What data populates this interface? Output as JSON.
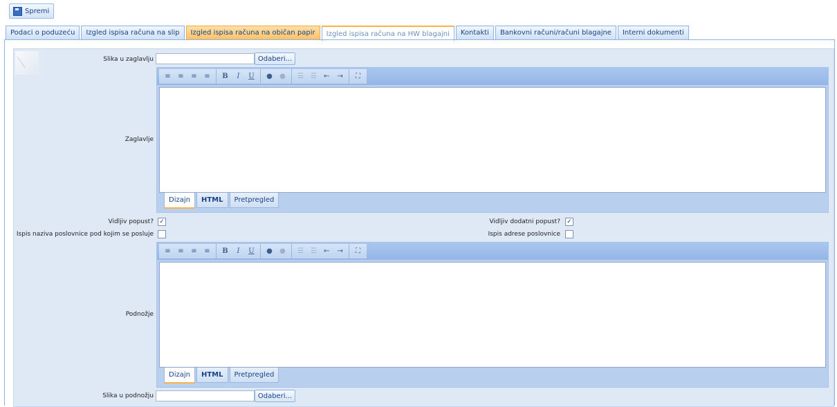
{
  "toolbar": {
    "save_label": "Spremi"
  },
  "tabs": [
    "Podaci o poduzeću",
    "Izgled ispisa računa na slip",
    "Izgled ispisa računa na običan papir",
    "Izgled ispisa računa na HW blagajni",
    "Kontakti",
    "Bankovni računi/računi blagajne",
    "Interni dokumenti"
  ],
  "form": {
    "header_image_label": "Slika u zaglavlju",
    "header_image_value": "",
    "browse_label": "Odaberi...",
    "header_label": "Zaglavlje",
    "footer_label": "Podnožje",
    "footer_image_label": "Slika u podnožju",
    "footer_image_value": "",
    "show_discount_label": "Vidljiv popust?",
    "show_discount_checked": true,
    "show_extra_discount_label": "Vidljiv dodatni popust?",
    "show_extra_discount_checked": true,
    "print_branch_name_label": "Ispis naziva poslovnice pod kojim se posluje",
    "print_branch_name_checked": false,
    "print_branch_address_label": "Ispis adrese poslovnice",
    "print_branch_address_checked": false
  },
  "editor": {
    "modes": [
      "Dizajn",
      "HTML",
      "Pretpregled"
    ],
    "buttons": {
      "bold": "B",
      "italic": "I",
      "underline": "U"
    }
  }
}
